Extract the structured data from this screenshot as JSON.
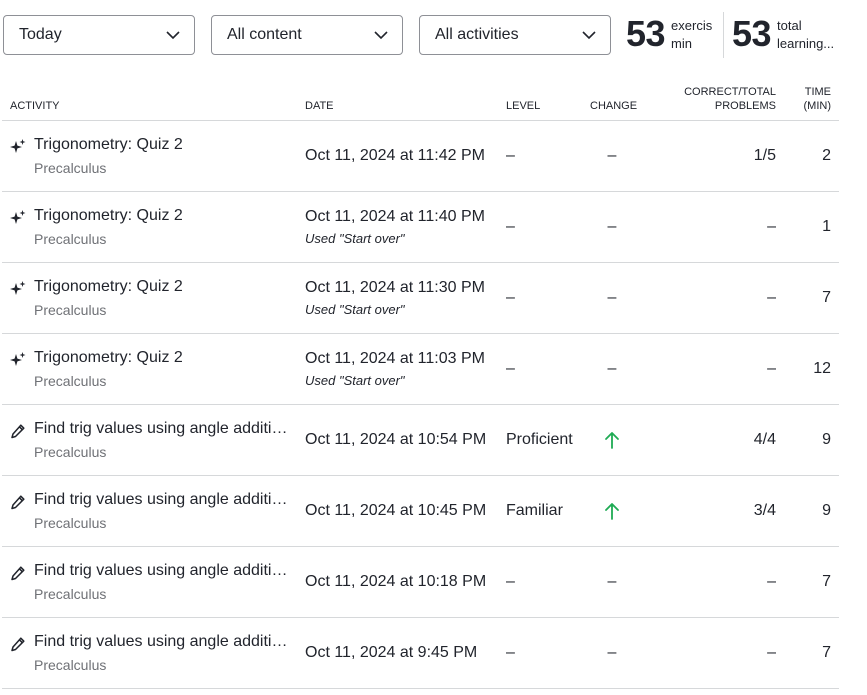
{
  "filters": {
    "time": "Today",
    "content": "All content",
    "activity": "All activities"
  },
  "stats": [
    {
      "value": "53",
      "label_line1": "exercis",
      "label_line2": "min"
    },
    {
      "value": "53",
      "label_line1": "total",
      "label_line2": "learning..."
    }
  ],
  "table": {
    "headers": {
      "activity": "ACTIVITY",
      "date": "DATE",
      "level": "LEVEL",
      "change": "CHANGE",
      "correct_line1": "CORRECT/TOTAL",
      "correct_line2": "PROBLEMS",
      "time_line1": "TIME",
      "time_line2": "(MIN)"
    },
    "rows": [
      {
        "icon": "sparkle-icon",
        "title": "Trigonometry: Quiz 2",
        "course": "Precalculus",
        "date": "Oct 11, 2024 at 11:42 PM",
        "note": "",
        "level": "–",
        "change": "–",
        "correct": "1/5",
        "time": "2"
      },
      {
        "icon": "sparkle-icon",
        "title": "Trigonometry: Quiz 2",
        "course": "Precalculus",
        "date": "Oct 11, 2024 at 11:40 PM",
        "note": "Used \"Start over\"",
        "level": "–",
        "change": "–",
        "correct": "–",
        "time": "1"
      },
      {
        "icon": "sparkle-icon",
        "title": "Trigonometry: Quiz 2",
        "course": "Precalculus",
        "date": "Oct 11, 2024 at 11:30 PM",
        "note": "Used \"Start over\"",
        "level": "–",
        "change": "–",
        "correct": "–",
        "time": "7"
      },
      {
        "icon": "sparkle-icon",
        "title": "Trigonometry: Quiz 2",
        "course": "Precalculus",
        "date": "Oct 11, 2024 at 11:03 PM",
        "note": "Used \"Start over\"",
        "level": "–",
        "change": "–",
        "correct": "–",
        "time": "12"
      },
      {
        "icon": "pencil-icon",
        "title": "Find trig values using angle additio...",
        "course": "Precalculus",
        "date": "Oct 11, 2024 at 10:54 PM",
        "note": "",
        "level": "Proficient",
        "change": "up",
        "correct": "4/4",
        "time": "9"
      },
      {
        "icon": "pencil-icon",
        "title": "Find trig values using angle additio...",
        "course": "Precalculus",
        "date": "Oct 11, 2024 at 10:45 PM",
        "note": "",
        "level": "Familiar",
        "change": "up",
        "correct": "3/4",
        "time": "9"
      },
      {
        "icon": "pencil-icon",
        "title": "Find trig values using angle additio...",
        "course": "Precalculus",
        "date": "Oct 11, 2024 at 10:18 PM",
        "note": "",
        "level": "–",
        "change": "–",
        "correct": "–",
        "time": "7"
      },
      {
        "icon": "pencil-icon",
        "title": "Find trig values using angle additio...",
        "course": "Precalculus",
        "date": "Oct 11, 2024 at 9:45 PM",
        "note": "",
        "level": "–",
        "change": "–",
        "correct": "–",
        "time": "7"
      }
    ]
  },
  "colors": {
    "text": "#21242c",
    "subtext": "#6f7176",
    "border": "#d6d8da",
    "arrow_up": "#1fab54"
  }
}
